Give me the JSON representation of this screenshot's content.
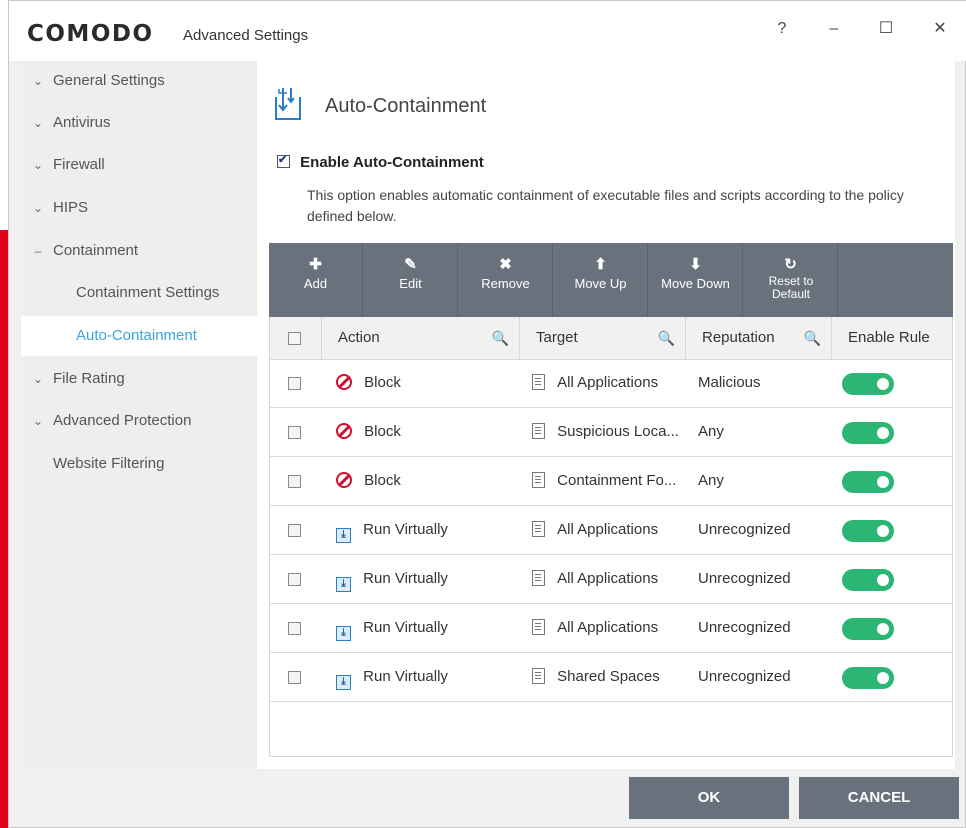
{
  "window": {
    "logo": "COMODO",
    "title": "Advanced Settings",
    "help": "?",
    "minimize": "–",
    "maximize": "☐",
    "close": "✕"
  },
  "sidebar": {
    "items": [
      {
        "label": "General Settings",
        "arrow": "⌄"
      },
      {
        "label": "Antivirus",
        "arrow": "⌄"
      },
      {
        "label": "Firewall",
        "arrow": "⌄"
      },
      {
        "label": "HIPS",
        "arrow": "⌄"
      },
      {
        "label": "Containment",
        "arrow": "–"
      },
      {
        "label": "Containment Settings",
        "arrow": ""
      },
      {
        "label": "Auto-Containment",
        "arrow": ""
      },
      {
        "label": "File Rating",
        "arrow": "⌄"
      },
      {
        "label": "Advanced Protection",
        "arrow": "⌄"
      },
      {
        "label": "Website Filtering",
        "arrow": ""
      }
    ]
  },
  "main": {
    "title": "Auto-Containment",
    "enable_label": "Enable Auto-Containment",
    "enable_checked": true,
    "description": "This option enables automatic containment of executable files and scripts according to the policy defined below."
  },
  "toolbar": {
    "buttons": [
      {
        "icon": "✚",
        "label": "Add"
      },
      {
        "icon": "✎",
        "label": "Edit"
      },
      {
        "icon": "✖",
        "label": "Remove"
      },
      {
        "icon": "⬆",
        "label": "Move Up"
      },
      {
        "icon": "⬇",
        "label": "Move Down"
      },
      {
        "icon": "↻",
        "label": "Reset to Default"
      }
    ]
  },
  "table": {
    "headers": {
      "action": "Action",
      "target": "Target",
      "reputation": "Reputation",
      "enable": "Enable Rule"
    },
    "rows": [
      {
        "action": "Block",
        "action_type": "block",
        "target": "All Applications",
        "reputation": "Malicious",
        "enabled": true
      },
      {
        "action": "Block",
        "action_type": "block",
        "target": "Suspicious Loca...",
        "reputation": "Any",
        "enabled": true
      },
      {
        "action": "Block",
        "action_type": "block",
        "target": "Containment Fo...",
        "reputation": "Any",
        "enabled": true
      },
      {
        "action": "Run Virtually",
        "action_type": "run",
        "target": "All Applications",
        "reputation": "Unrecognized",
        "enabled": true
      },
      {
        "action": "Run Virtually",
        "action_type": "run",
        "target": "All Applications",
        "reputation": "Unrecognized",
        "enabled": true
      },
      {
        "action": "Run Virtually",
        "action_type": "run",
        "target": "All Applications",
        "reputation": "Unrecognized",
        "enabled": true
      },
      {
        "action": "Run Virtually",
        "action_type": "run",
        "target": "Shared Spaces",
        "reputation": "Unrecognized",
        "enabled": true
      }
    ]
  },
  "footer": {
    "ok": "OK",
    "cancel": "CANCEL"
  },
  "colors": {
    "accent": "#3aa5dc",
    "toolbar": "#69727c",
    "toggle_on": "#2bb673",
    "block": "#d0102c",
    "brand_red": "#e2001a"
  }
}
